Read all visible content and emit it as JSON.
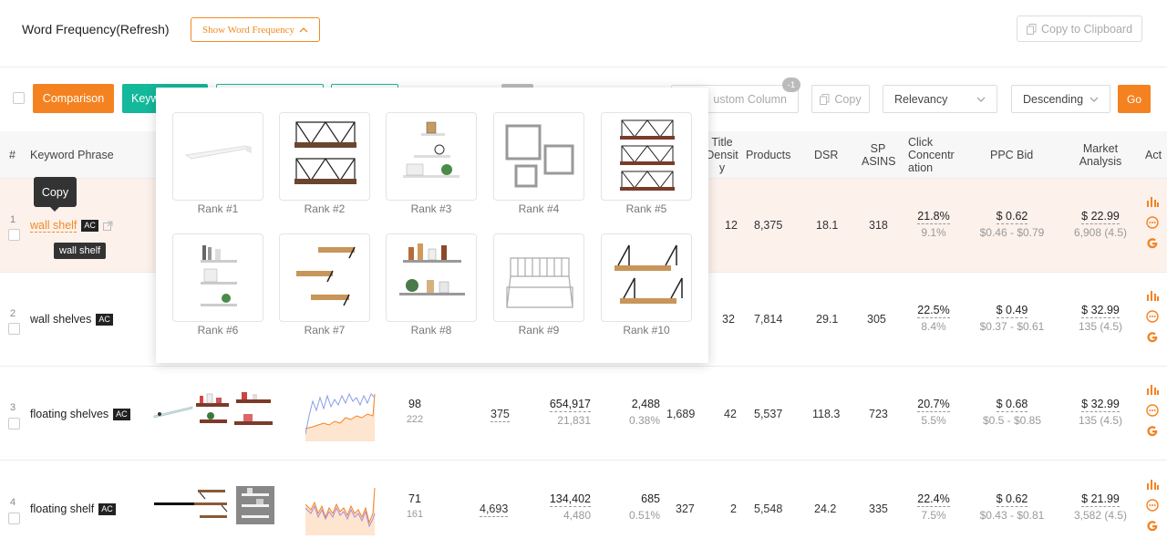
{
  "header": {
    "title": "Word Frequency(Refresh)",
    "show_wf_label": "Show Word Frequency",
    "copy_clipboard_label": "Copy to Clipboard"
  },
  "toolbar": {
    "comparison_label": "Comparison",
    "keyword_label": "Keyw",
    "custom_column_label": "ustom Column",
    "custom_badge": "-1",
    "copy_label": "Copy",
    "sort_field": "Relevancy",
    "sort_order": "Descending",
    "go_label": "Go"
  },
  "columns": {
    "index": "#",
    "keyword": "Keyword Phrase",
    "title_density": "Title Densit y",
    "products": "Products",
    "dsr": "DSR",
    "sp_asins": "SP ASINS",
    "click_concentration": "Click Concentr ation",
    "ppc_bid": "PPC Bid",
    "market_analysis": "Market Analysis",
    "action": "Act"
  },
  "tooltips": {
    "copy": "Copy",
    "keyword": "wall shelf"
  },
  "popup": {
    "ranks": [
      "Rank #1",
      "Rank #2",
      "Rank #3",
      "Rank #4",
      "Rank #5",
      "Rank #6",
      "Rank #7",
      "Rank #8",
      "Rank #9",
      "Rank #10"
    ]
  },
  "rows": [
    {
      "index": "1",
      "keyword": "wall shelf",
      "ac": "AC",
      "title_density": "12",
      "products": "8,375",
      "dsr": "18.1",
      "sp_asins": "318",
      "click_pct": "21.8%",
      "click_sub": "9.1%",
      "ppc_bid": "$ 0.62",
      "ppc_range": "$0.46 - $0.79",
      "market_price": "$ 22.99",
      "market_sub": "6,908 (4.5)"
    },
    {
      "index": "2",
      "keyword": "wall shelves",
      "ac": "AC",
      "title_density": "32",
      "products": "7,814",
      "dsr": "29.1",
      "sp_asins": "305",
      "click_pct": "22.5%",
      "click_sub": "8.4%",
      "ppc_bid": "$ 0.49",
      "ppc_range": "$0.37 - $0.61",
      "market_price": "$ 32.99",
      "market_sub": "135 (4.5)"
    },
    {
      "index": "3",
      "keyword": "floating shelves",
      "ac": "AC",
      "col_a_top": "98",
      "col_a_bot": "222",
      "col_b": "375",
      "col_c_top": "654,917",
      "col_c_bot": "21,831",
      "col_d_top": "2,488",
      "col_d_bot": "0.38%",
      "col_e": "1,689",
      "title_density": "42",
      "products": "5,537",
      "dsr": "118.3",
      "sp_asins": "723",
      "click_pct": "20.7%",
      "click_sub": "5.5%",
      "ppc_bid": "$ 0.68",
      "ppc_range": "$0.5 - $0.85",
      "market_price": "$ 32.99",
      "market_sub": "135 (4.5)"
    },
    {
      "index": "4",
      "keyword": "floating shelf",
      "ac": "AC",
      "col_a_top": "71",
      "col_a_bot": "161",
      "col_b": "4,693",
      "col_c_top": "134,402",
      "col_c_bot": "4,480",
      "col_d_top": "685",
      "col_d_bot": "0.51%",
      "col_e": "327",
      "title_density": "2",
      "products": "5,548",
      "dsr": "24.2",
      "sp_asins": "335",
      "click_pct": "22.4%",
      "click_sub": "7.5%",
      "ppc_bid": "$ 0.62",
      "ppc_range": "$0.43 - $0.81",
      "market_price": "$ 21.99",
      "market_sub": "3,582 (4.5)"
    }
  ],
  "colors": {
    "orange": "#f58220",
    "teal": "#14b89a",
    "highlight_row": "#fdf1ec"
  }
}
